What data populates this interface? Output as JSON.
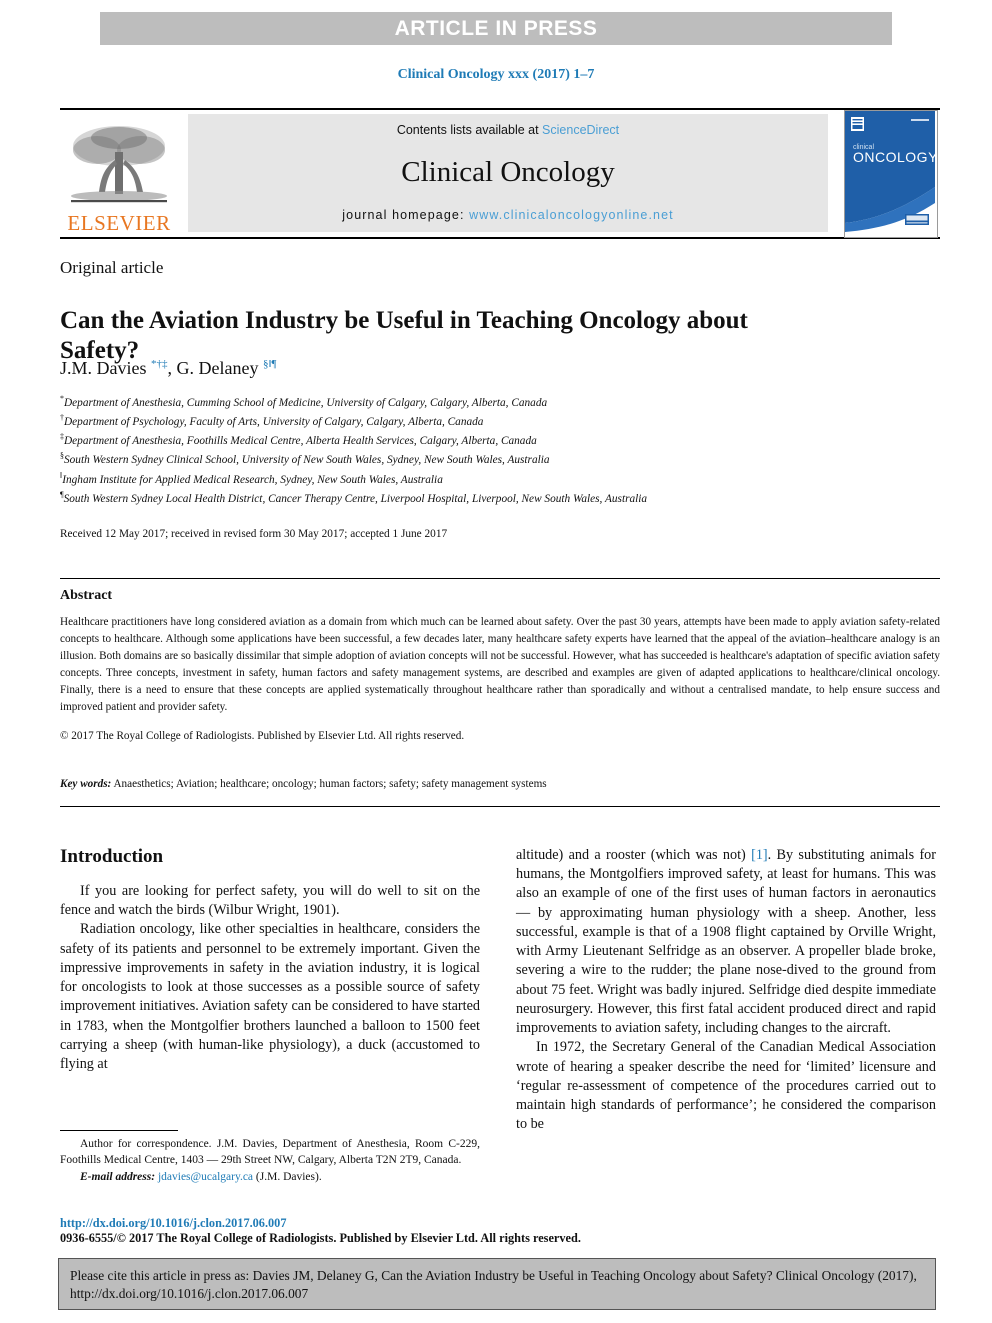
{
  "banner": {
    "text": "ARTICLE IN PRESS"
  },
  "running_head": "Clinical Oncology xxx (2017) 1–7",
  "masthead": {
    "publisher": "ELSEVIER",
    "contents_prefix": "Contents lists available at ",
    "contents_link": "ScienceDirect",
    "journal_title": "Clinical Oncology",
    "homepage_prefix": "journal homepage: ",
    "homepage_link": "www.clinicaloncologyonline.net",
    "cover_title_small": "clinical",
    "cover_title_large": "ONCOLOGY",
    "colors": {
      "elsevier_orange": "#e87722",
      "link_blue": "#4a9ed4",
      "cover_blue": "#1f5fa8",
      "banner_gray": "#bdbdbd",
      "box_gray": "#e6e6e6"
    }
  },
  "article": {
    "type_label": "Original article",
    "title": "Can the Aviation Industry be Useful in Teaching Oncology about Safety?",
    "authors_html": "J.M. Davies <sup>*†‡</sup>, G. Delaney <sup>§‖¶</sup>",
    "affiliations": [
      {
        "mark": "*",
        "text": "Department of Anesthesia, Cumming School of Medicine, University of Calgary, Calgary, Alberta, Canada"
      },
      {
        "mark": "†",
        "text": "Department of Psychology, Faculty of Arts, University of Calgary, Calgary, Alberta, Canada"
      },
      {
        "mark": "‡",
        "text": "Department of Anesthesia, Foothills Medical Centre, Alberta Health Services, Calgary, Alberta, Canada"
      },
      {
        "mark": "§",
        "text": "South Western Sydney Clinical School, University of New South Wales, Sydney, New South Wales, Australia"
      },
      {
        "mark": "‖",
        "text": "Ingham Institute for Applied Medical Research, Sydney, New South Wales, Australia"
      },
      {
        "mark": "¶",
        "text": "South Western Sydney Local Health District, Cancer Therapy Centre, Liverpool Hospital, Liverpool, New South Wales, Australia"
      }
    ],
    "received": "Received 12 May 2017; received in revised form 30 May 2017; accepted 1 June 2017"
  },
  "abstract": {
    "heading": "Abstract",
    "body": "Healthcare practitioners have long considered aviation as a domain from which much can be learned about safety. Over the past 30 years, attempts have been made to apply aviation safety-related concepts to healthcare. Although some applications have been successful, a few decades later, many healthcare safety experts have learned that the appeal of the aviation–healthcare analogy is an illusion. Both domains are so basically dissimilar that simple adoption of aviation concepts will not be successful. However, what has succeeded is healthcare's adaptation of specific aviation safety concepts. Three concepts, investment in safety, human factors and safety management systems, are described and examples are given of adapted applications to healthcare/clinical oncology. Finally, there is a need to ensure that these concepts are applied systematically throughout healthcare rather than sporadically and without a centralised mandate, to help ensure success and improved patient and provider safety.",
    "copyright": "© 2017 The Royal College of Radiologists. Published by Elsevier Ltd. All rights reserved.",
    "keywords_label": "Key words:",
    "keywords_value": " Anaesthetics; Aviation; healthcare; oncology; human factors; safety; safety management systems"
  },
  "body": {
    "intro_heading": "Introduction",
    "left_paragraphs": [
      "If you are looking for perfect safety, you will do well to sit on the fence and watch the birds (Wilbur Wright, 1901).",
      "Radiation oncology, like other specialties in healthcare, considers the safety of its patients and personnel to be extremely important. Given the impressive improvements in safety in the aviation industry, it is logical for oncologists to look at those successes as a possible source of safety improvement initiatives. Aviation safety can be considered to have started in 1783, when the Montgolfier brothers launched a balloon to 1500 feet carrying a sheep (with human-like physiology), a duck (accustomed to flying at"
    ],
    "right_paragraph_1_pre": "altitude) and a rooster (which was not) ",
    "right_paragraph_1_ref": "[1]",
    "right_paragraph_1_post": ". By substituting animals for humans, the Montgolfiers improved safety, at least for humans. This was also an example of one of the first uses of human factors in aeronautics — by approximating human physiology with a sheep. Another, less successful, example is that of a 1908 flight captained by Orville Wright, with Army Lieutenant Selfridge as an observer. A propeller blade broke, severing a wire to the rudder; the plane nose-dived to the ground from about 75 feet. Wright was badly injured. Selfridge died despite immediate neurosurgery. However, this first fatal accident produced direct and rapid improvements to aviation safety, including changes to the aircraft.",
    "right_paragraph_2": "In 1972, the Secretary General of the Canadian Medical Association wrote of hearing a speaker describe the need for ‘limited’ licensure and ‘regular re-assessment of competence of the procedures carried out to maintain high standards of performance’; he considered the comparison to be"
  },
  "footnote": {
    "correspondence": "Author for correspondence. J.M. Davies, Department of Anesthesia, Room C-229, Foothills Medical Centre, 1403 — 29th Street NW, Calgary, Alberta T2N 2T9, Canada.",
    "email_label": "E-mail address:",
    "email": "jdavies@ucalgary.ca",
    "email_suffix": "(J.M. Davies).",
    "doi": "http://dx.doi.org/10.1016/j.clon.2017.06.007",
    "issn_line": "0936-6555/© 2017 The Royal College of Radiologists. Published by Elsevier Ltd. All rights reserved."
  },
  "cite_box": {
    "text": "Please cite this article in press as: Davies JM, Delaney G, Can the Aviation Industry be Useful in Teaching Oncology about Safety? Clinical Oncology (2017), http://dx.doi.org/10.1016/j.clon.2017.06.007"
  }
}
